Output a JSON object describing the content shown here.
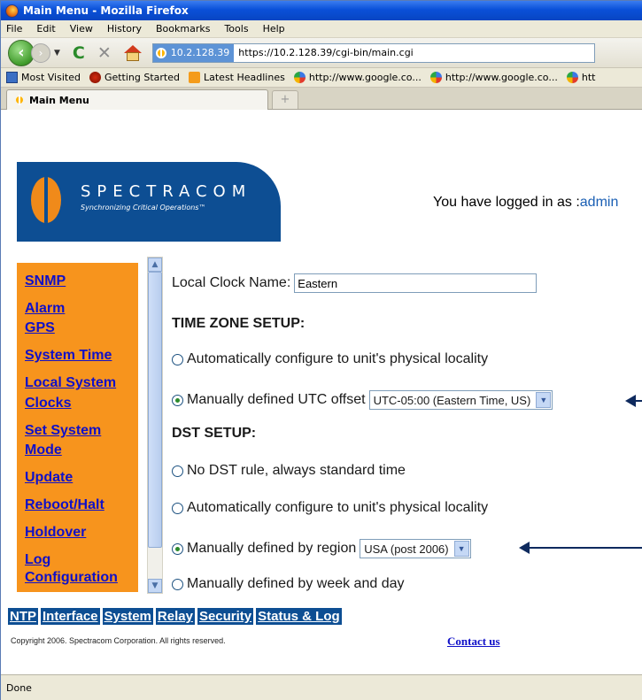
{
  "window": {
    "title": "Main Menu - Mozilla Firefox"
  },
  "menubar": {
    "items": [
      "File",
      "Edit",
      "View",
      "History",
      "Bookmarks",
      "Tools",
      "Help"
    ]
  },
  "navbar": {
    "site_badge": "10.2.128.39",
    "url": "https://10.2.128.39/cgi-bin/main.cgi"
  },
  "bookmarks": {
    "items": [
      {
        "label": "Most Visited",
        "icon": "most-visited-icon"
      },
      {
        "label": "Getting Started",
        "icon": "getting-started-icon"
      },
      {
        "label": "Latest Headlines",
        "icon": "rss-icon"
      },
      {
        "label": "http://www.google.co...",
        "icon": "google-icon"
      },
      {
        "label": "http://www.google.co...",
        "icon": "google-icon"
      },
      {
        "label": "htt",
        "icon": "google-icon"
      }
    ]
  },
  "tab": {
    "title": "Main Menu",
    "new_tab_symbol": "+"
  },
  "page": {
    "logo": {
      "name": "SPECTRACOM",
      "tagline": "Synchronizing Critical Operations™"
    },
    "login": {
      "prefix": "You have logged in as :",
      "user": "admin"
    },
    "sidebar": {
      "links": [
        "SNMP",
        "Alarm",
        "GPS",
        "System Time",
        "Local System",
        "Clocks",
        "Set System",
        "Mode",
        "Update",
        "Reboot/Halt",
        "Holdover",
        "Log",
        "Configuration"
      ]
    },
    "form": {
      "clock_name_label": "Local Clock Name:",
      "clock_name_value": "Eastern",
      "tz_heading": "TIME ZONE SETUP:",
      "tz_auto": "Automatically configure to unit's physical locality",
      "tz_manual": "Manually defined UTC offset",
      "tz_select": "UTC-05:00 (Eastern Time, US)",
      "dst_heading": "DST SETUP:",
      "dst_none": "No DST rule, always standard time",
      "dst_auto": "Automatically configure to unit's physical locality",
      "dst_region": "Manually defined by region",
      "dst_region_select": "USA (post 2006)",
      "dst_week": "Manually defined by week and day"
    },
    "bottom_nav": [
      "NTP",
      "Interface",
      "System",
      "Relay",
      "Security",
      "Status & Log"
    ],
    "copyright": "Copyright 2006. Spectracom Corporation. All rights reserved.",
    "contact": "Contact us"
  },
  "status": {
    "text": "Done"
  },
  "colors": {
    "sidebar": "#f7941d",
    "brand_blue": "#0d4e93",
    "link": "#1010c8"
  }
}
